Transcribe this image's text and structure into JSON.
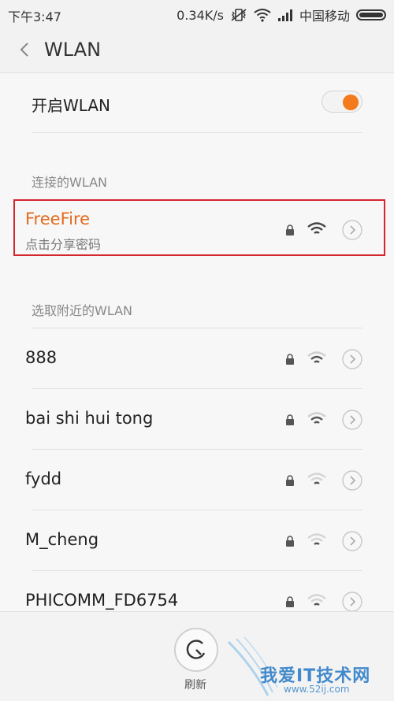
{
  "status_bar": {
    "time": "下午3:47",
    "speed": "0.34K/s",
    "carrier": "中国移动"
  },
  "nav": {
    "title": "WLAN"
  },
  "toggle": {
    "label": "开启WLAN",
    "enabled": true,
    "accent": "#f37b1d"
  },
  "sections": {
    "connected_header": "连接的WLAN",
    "nearby_header": "选取附近的WLAN"
  },
  "connected": {
    "name": "FreeFire",
    "subtitle": "点击分享密码",
    "name_color": "#e36b1e",
    "highlight_color": "#d3262d"
  },
  "networks": [
    {
      "name": "888",
      "secured": true,
      "signal": "medium"
    },
    {
      "name": "bai shi hui tong",
      "secured": true,
      "signal": "medium"
    },
    {
      "name": "fydd",
      "secured": true,
      "signal": "weak"
    },
    {
      "name": "M_cheng",
      "secured": true,
      "signal": "weak"
    },
    {
      "name": "PHICOMM_FD6754",
      "secured": true,
      "signal": "weak"
    }
  ],
  "bottom": {
    "refresh_label": "刷新"
  },
  "watermark": {
    "text": "我爱IT技术网",
    "url": "www.52ij.com"
  }
}
